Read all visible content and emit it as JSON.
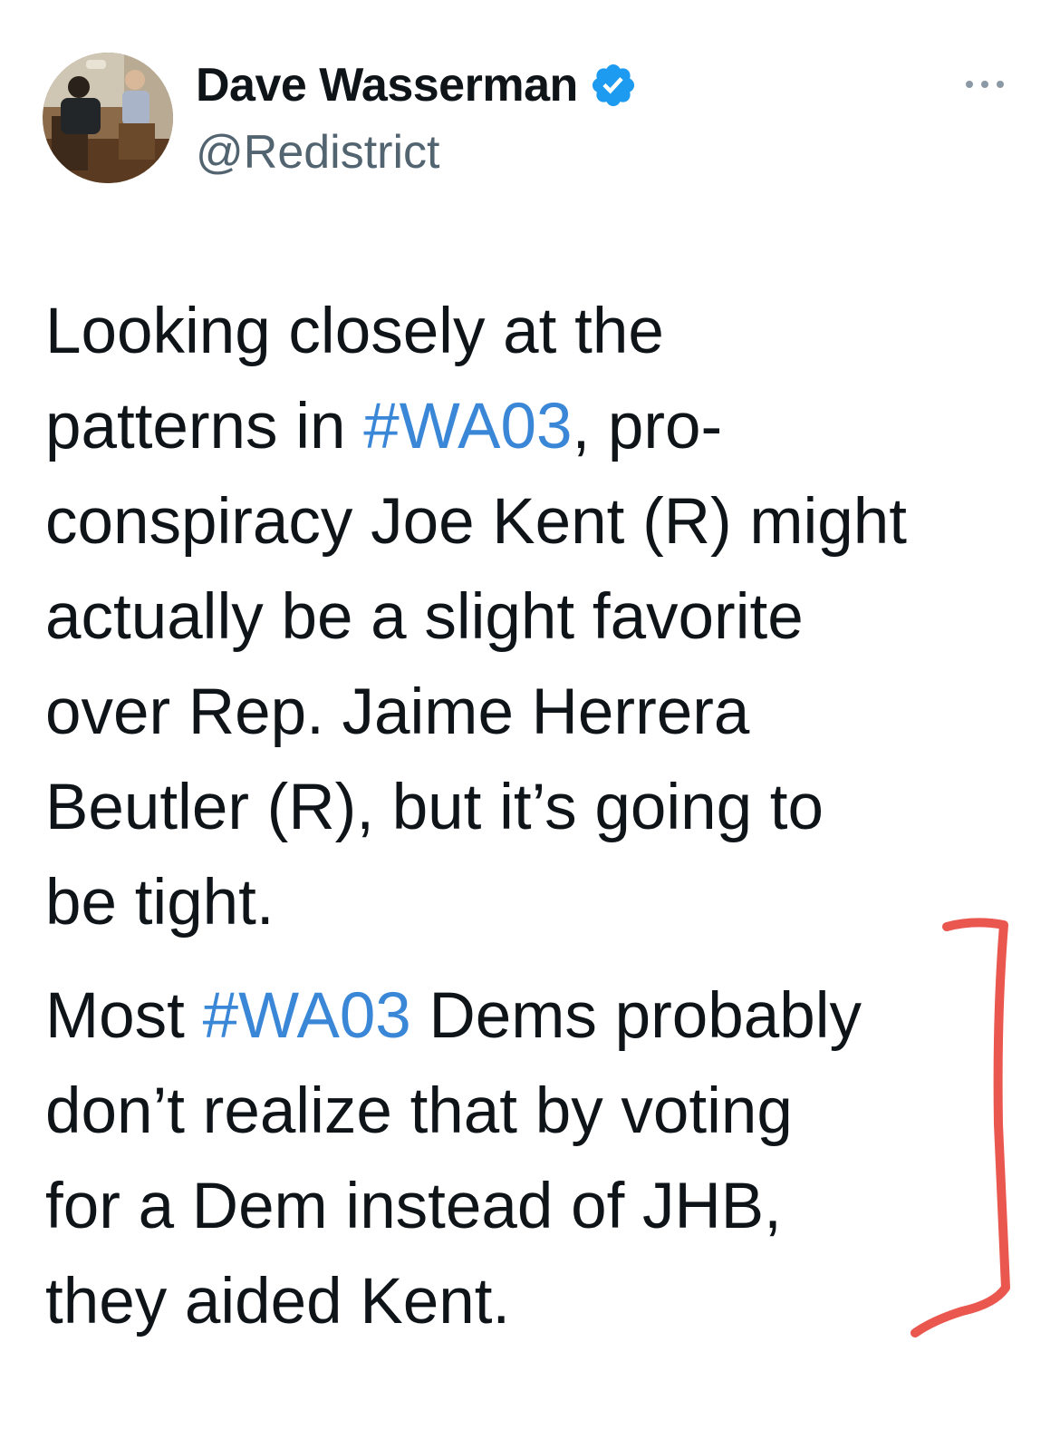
{
  "author": {
    "name": "Dave Wasserman",
    "handle": "@Redistrict",
    "verified_icon": "verified-badge-icon",
    "more_icon": "more-options-icon"
  },
  "tweet": {
    "paragraph_1": {
      "line_1": "Looking closely at the",
      "line_2_pre": "patterns in ",
      "line_2_hashtag": "#WA03",
      "line_2_post": ", pro-",
      "line_3": "conspiracy Joe Kent (R) might",
      "line_4": "actually be a slight favorite",
      "line_5": "over Rep. Jaime Herrera",
      "line_6": "Beutler (R), but it’s going to",
      "line_7": "be tight."
    },
    "paragraph_2": {
      "line_1_pre": "Most ",
      "line_1_hashtag": "#WA03",
      "line_1_post": " Dems probably",
      "line_2": "don’t realize that by voting",
      "line_3": "for a Dem instead of JHB,",
      "line_4": "they aided Kent."
    }
  },
  "colors": {
    "text": "#0f1419",
    "secondary": "#536471",
    "hashtag": "#3a87d8",
    "verified": "#1d9bf0",
    "annotation": "#e8453c"
  }
}
